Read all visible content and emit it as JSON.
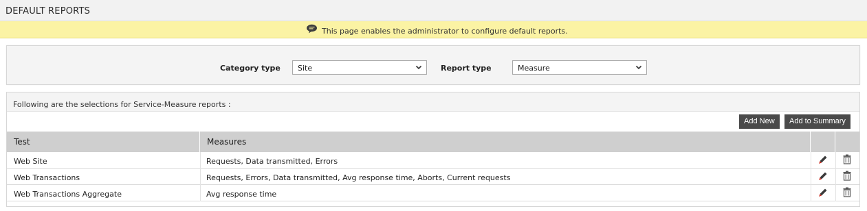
{
  "header": {
    "title": "DEFAULT REPORTS"
  },
  "info": {
    "icon": "speech-bubble-icon",
    "message": "This page enables the administrator to configure default reports."
  },
  "filters": {
    "category_label": "Category type",
    "category_value": "Site",
    "report_label": "Report type",
    "report_value": "Measure"
  },
  "results": {
    "caption": "Following are the selections for Service-Measure reports :",
    "add_new_label": "Add New",
    "add_summary_label": "Add to Summary",
    "columns": {
      "test": "Test",
      "measures": "Measures"
    },
    "rows": [
      {
        "test": "Web Site",
        "measures": "Requests, Data transmitted, Errors"
      },
      {
        "test": "Web Transactions",
        "measures": "Requests, Errors, Data transmitted, Avg response time, Aborts, Current requests"
      },
      {
        "test": "Web Transactions Aggregate",
        "measures": "Avg response time"
      }
    ]
  },
  "colors": {
    "info_bar": "#fbf3a4",
    "button": "#4a4a4a",
    "grid_header": "#cfcfcf",
    "edit_tip": "#cc2a1e"
  }
}
